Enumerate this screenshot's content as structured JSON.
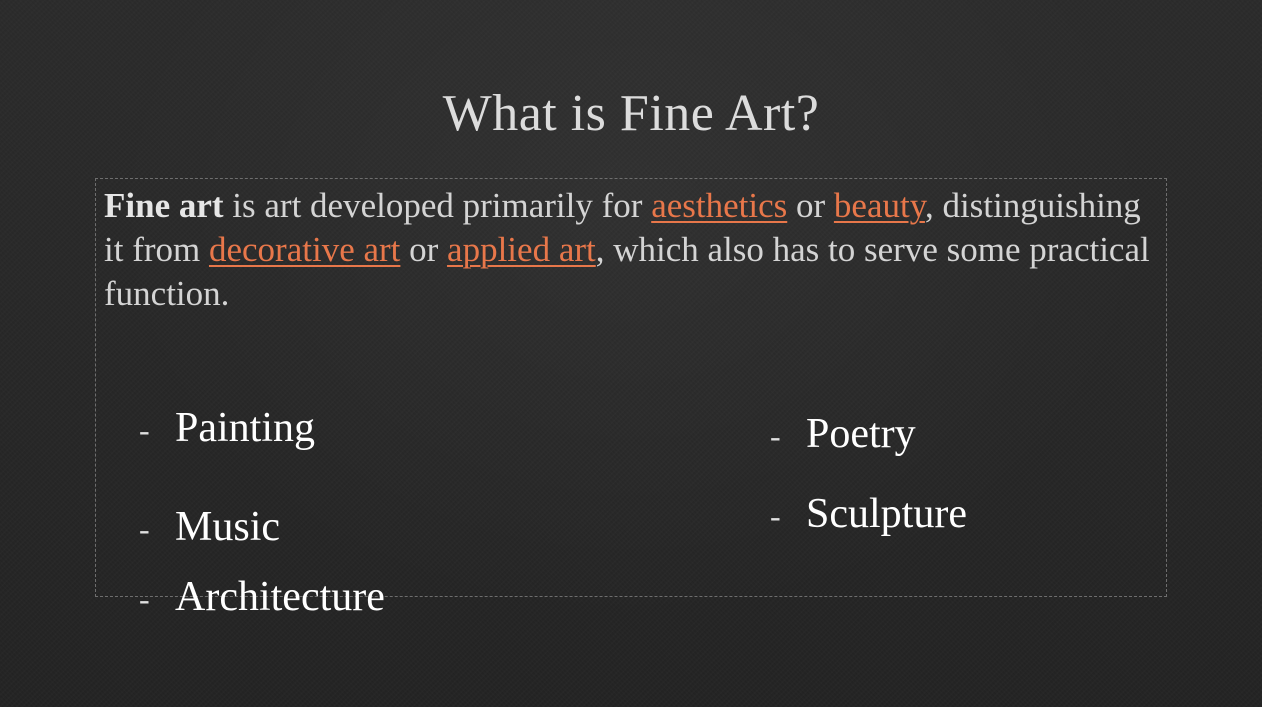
{
  "slide": {
    "title": "What is Fine Art?",
    "definition": {
      "term": "Fine art",
      "part1": " is art developed primarily for ",
      "link_aesthetics": "aesthetics",
      "part2": " or ",
      "link_beauty": "beauty",
      "part3": ", distinguishing it from ",
      "link_decorative_art": "decorative art",
      "part4": " or ",
      "link_applied_art": "applied art",
      "part5": ", which also has to serve some practical function."
    },
    "bullets_left": [
      {
        "dash": "-",
        "label": "Painting"
      },
      {
        "dash": "-",
        "label": "Music"
      },
      {
        "dash": "-",
        "label": "Architecture"
      }
    ],
    "bullets_right": [
      {
        "dash": "-",
        "label": "Poetry"
      },
      {
        "dash": "-",
        "label": "Sculpture"
      }
    ],
    "colors": {
      "link": "#e8774a",
      "background": "#262626",
      "text": "#d9d9d9"
    }
  }
}
